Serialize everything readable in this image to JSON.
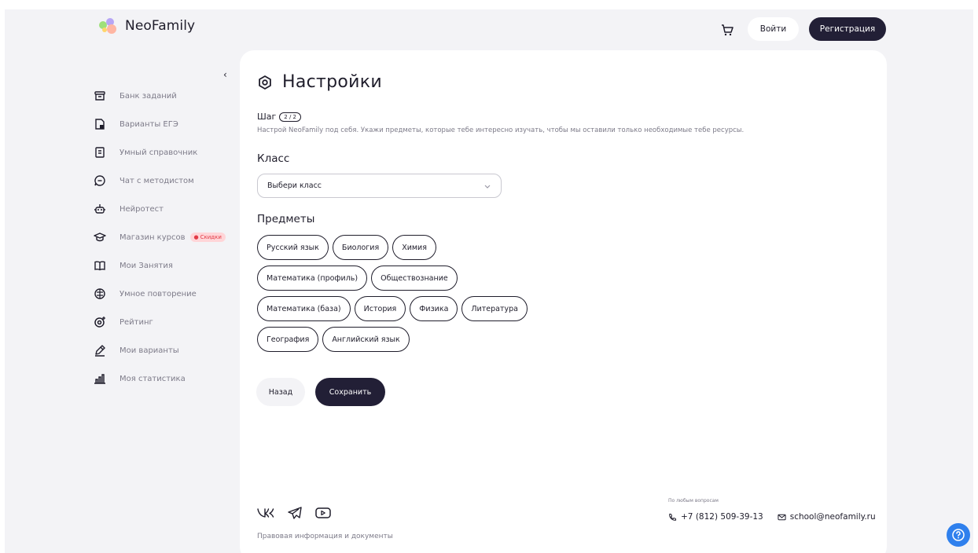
{
  "header": {
    "logo_text": "NeoFamily",
    "login_label": "Войти",
    "register_label": "Регистрация"
  },
  "sidebar": {
    "items": [
      {
        "label": "Банк заданий",
        "icon": "archive-icon"
      },
      {
        "label": "Варианты ЕГЭ",
        "icon": "document-edit-icon"
      },
      {
        "label": "Умный справочник",
        "icon": "book-icon"
      },
      {
        "label": "Чат с методистом",
        "icon": "chat-icon"
      },
      {
        "label": "Нейротест",
        "icon": "robot-icon"
      },
      {
        "label": "Магазин курсов",
        "icon": "graduation-cap-icon",
        "badge": "Скидки"
      },
      {
        "label": "Мои Занятия",
        "icon": "open-book-icon"
      },
      {
        "label": "Умное повторение",
        "icon": "brain-icon"
      },
      {
        "label": "Рейтинг",
        "icon": "rating-icon"
      },
      {
        "label": "Мои варианты",
        "icon": "pencil-icon"
      },
      {
        "label": "Моя статистика",
        "icon": "bar-chart-icon"
      }
    ]
  },
  "main": {
    "title": "Настройки",
    "step_label": "Шаг",
    "step_value": "2 / 2",
    "description": "Настрой NeoFamily под себя. Укажи предметы, которые тебе интересно изучать, чтобы мы оставили только необходимые тебе ресурсы.",
    "class_heading": "Класс",
    "class_select_value": "Выбери класс",
    "subjects_heading": "Предметы",
    "subjects": [
      [
        "Русский язык",
        "Биология",
        "Химия"
      ],
      [
        "Математика (профиль)",
        "Обществознание"
      ],
      [
        "Математика (база)",
        "История",
        "Физика",
        "Литература"
      ],
      [
        "География",
        "Английский язык"
      ]
    ],
    "back_label": "Назад",
    "save_label": "Сохранить"
  },
  "footer": {
    "legal": "Правовая информация и документы",
    "any_questions": "По любым вопросам",
    "phone": "+7 (812) 509-39-13",
    "email": "school@neofamily.ru"
  },
  "colors": {
    "accent_dark": "#221f36",
    "background": "#f3f3f6",
    "help_button": "#2f80ed",
    "badge_red": "#e23b47"
  }
}
